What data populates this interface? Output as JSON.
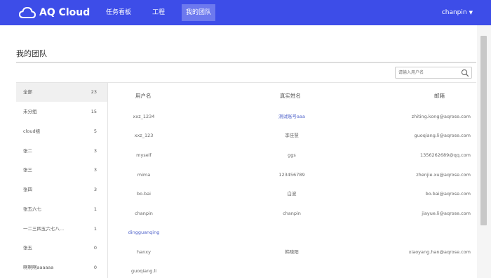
{
  "header": {
    "brand": "AQ Cloud",
    "nav": [
      {
        "label": "任务看板",
        "active": false
      },
      {
        "label": "工程",
        "active": false
      },
      {
        "label": "我的团队",
        "active": true
      }
    ],
    "user": "chanpin",
    "user_caret": "▼",
    "bg_color": "#3d4de8"
  },
  "page": {
    "title": "我的团队"
  },
  "search": {
    "placeholder": "请输入用户名"
  },
  "sidebar": {
    "items": [
      {
        "name": "全部",
        "count": "23",
        "active": true
      },
      {
        "name": "未分组",
        "count": "15",
        "active": false
      },
      {
        "name": "cloud组",
        "count": "5",
        "active": false
      },
      {
        "name": "张二",
        "count": "3",
        "active": false
      },
      {
        "name": "张三",
        "count": "3",
        "active": false
      },
      {
        "name": "张四",
        "count": "3",
        "active": false
      },
      {
        "name": "张五六七",
        "count": "1",
        "active": false
      },
      {
        "name": "一二三四五六七八...",
        "count": "1",
        "active": false
      },
      {
        "name": "张五",
        "count": "0",
        "active": false
      },
      {
        "name": "啊啊啊aaaaaa",
        "count": "0",
        "active": false
      }
    ]
  },
  "table": {
    "columns": [
      "用户名",
      "真实姓名",
      "邮箱"
    ],
    "rows": [
      {
        "username": "xxz_1234",
        "realname": "测试账号aaa",
        "email": "zhiting.kong@aqrose.com",
        "username_link": false,
        "realname_link": true
      },
      {
        "username": "xxz_123",
        "realname": "李佳慧",
        "email": "guoqiang.li@aqrose.com",
        "username_link": false,
        "realname_link": false
      },
      {
        "username": "myself",
        "realname": "ggs",
        "email": "1356262689@qq.com",
        "username_link": false,
        "realname_link": false
      },
      {
        "username": "mima",
        "realname": "123456789",
        "email": "zhenjie.xu@aqrose.com",
        "username_link": false,
        "realname_link": false
      },
      {
        "username": "bo.bai",
        "realname": "白波",
        "email": "bo.bai@aqrose.com",
        "username_link": false,
        "realname_link": false
      },
      {
        "username": "chanpin",
        "realname": "chanpin",
        "email": "jiayue.li@aqrose.com",
        "username_link": false,
        "realname_link": false
      },
      {
        "username": "dingguanqing",
        "realname": "",
        "email": "",
        "username_link": true,
        "realname_link": false
      },
      {
        "username": "hanxy",
        "realname": "韩晓阳",
        "email": "xiaoyang.han@aqrose.com",
        "username_link": false,
        "realname_link": false
      },
      {
        "username": "guoqiang.li",
        "realname": "",
        "email": "",
        "username_link": false,
        "realname_link": false
      }
    ]
  },
  "icons": {
    "logo": "cloud-logo-icon",
    "search": "search-icon",
    "user_menu": "caret-down-icon"
  }
}
